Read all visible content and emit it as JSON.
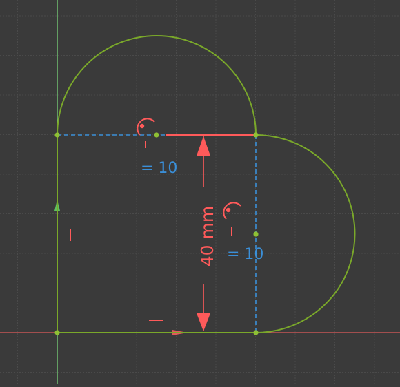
{
  "viewport": {
    "background": "#3a3a3a",
    "grid_color": "#4a4a4a",
    "minor_grid_color": "#404040"
  },
  "axes": {
    "x_axis_color": "#e05a5a",
    "y_axis_color": "#7fe07f"
  },
  "sketch": {
    "geometry_color": "#7aa82a",
    "point_color": "#8fc034",
    "construction_color": "#3a8fd8",
    "constraint_color": "#ff5a5a"
  },
  "dimension": {
    "label": "40 mm"
  },
  "constraints": {
    "top_arc_label": "= 10",
    "right_arc_label": "= 10",
    "vertical_marker": "I",
    "horizontal_marker_top": "—",
    "horizontal_marker_bottom": "—",
    "horizontal_marker_right": "—"
  }
}
